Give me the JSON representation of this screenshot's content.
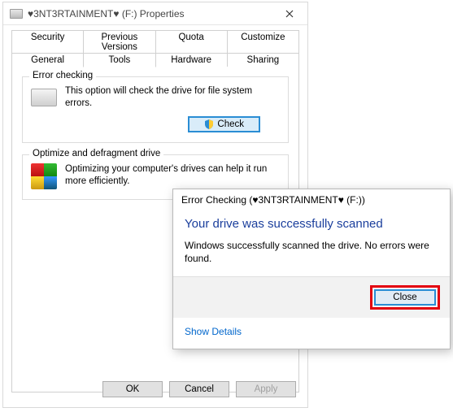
{
  "propWindow": {
    "title": "♥3NT3RTAINMENT♥ (F:) Properties",
    "tabsTop": [
      "Security",
      "Previous Versions",
      "Quota",
      "Customize"
    ],
    "tabsBottom": [
      "General",
      "Tools",
      "Hardware",
      "Sharing"
    ],
    "activeTab": "Tools",
    "errorChecking": {
      "legend": "Error checking",
      "desc": "This option will check the drive for file system errors.",
      "button": "Check"
    },
    "optimize": {
      "legend": "Optimize and defragment drive",
      "desc": "Optimizing your computer's drives can help it run more efficiently."
    },
    "footer": {
      "ok": "OK",
      "cancel": "Cancel",
      "apply": "Apply"
    }
  },
  "dialog": {
    "title": "Error Checking (♥3NT3RTAINMENT♥ (F:))",
    "heading": "Your drive was successfully scanned",
    "body": "Windows successfully scanned the drive. No errors were found.",
    "close": "Close",
    "showDetails": "Show Details"
  }
}
